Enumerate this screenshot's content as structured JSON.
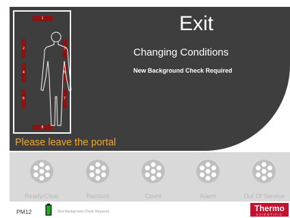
{
  "screen": {
    "title": "Exit",
    "status_line1": "Changing Conditions",
    "status_line2": "New Background Check Required",
    "instruction": "Please leave the portal"
  },
  "detectors": [
    "1",
    "2",
    "3",
    "4",
    "5",
    "6",
    "7",
    "8"
  ],
  "buttons": [
    {
      "label": "Ready/Clear",
      "icon": "detector-dial-icon"
    },
    {
      "label": "Recount",
      "icon": "detector-dial-icon"
    },
    {
      "label": "Count",
      "icon": "detector-dial-icon"
    },
    {
      "label": "Alarm",
      "icon": "detector-dial-icon"
    },
    {
      "label": "Out Of Service",
      "icon": "detector-dial-icon"
    }
  ],
  "footer": {
    "pm": "PM12",
    "status": "New Background Check Required"
  },
  "logo": {
    "brand": "Thermo",
    "sub": "SCIENTIFIC"
  },
  "colors": {
    "panel": "#3e3e3e",
    "alert": "#f0a830",
    "detector": "#8a1414",
    "button_bar": "#d9d9d9",
    "battery": "#22aa22",
    "logo": "#c8102e"
  }
}
